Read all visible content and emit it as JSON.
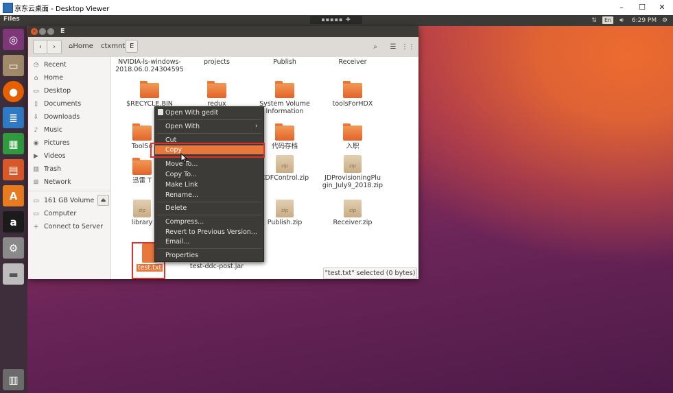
{
  "viewer": {
    "title": "京东云桌面 - Desktop Viewer",
    "min": "–",
    "max": "☐",
    "close": "✕"
  },
  "top_panel": {
    "app_title": "Files",
    "remote_bar": "▪▪▪▪▪ ✚ ▪▪▪▪▪",
    "keyboard": "En",
    "time": "6:29 PM"
  },
  "launcher": [
    {
      "name": "dash",
      "glyph": "◎",
      "color": "#7e3878"
    },
    {
      "name": "files",
      "glyph": "▭",
      "color": "#a08a6a"
    },
    {
      "name": "firefox",
      "glyph": "●",
      "color": "#e66000"
    },
    {
      "name": "writer",
      "glyph": "≣",
      "color": "#2e7ac4"
    },
    {
      "name": "calc",
      "glyph": "▦",
      "color": "#2f9a3e"
    },
    {
      "name": "impress",
      "glyph": "▤",
      "color": "#d9582a"
    },
    {
      "name": "software",
      "glyph": "A",
      "color": "#e87a1f"
    },
    {
      "name": "amazon",
      "glyph": "a",
      "color": "#1b1b1b"
    },
    {
      "name": "settings",
      "glyph": "⚙",
      "color": "#8a8a8a"
    },
    {
      "name": "drive",
      "glyph": "▬",
      "color": "#bdbdbd"
    },
    {
      "name": "trash",
      "glyph": "▥",
      "color": "#6b6b6b"
    }
  ],
  "window": {
    "title": "E",
    "breadcrumb": [
      "Home",
      "ctxmnt",
      "E"
    ],
    "sidebar": [
      "Recent",
      "Home",
      "Desktop",
      "Documents",
      "Downloads",
      "Music",
      "Pictures",
      "Videos",
      "Trash",
      "Network",
      "161 GB Volume",
      "Computer",
      "Connect to Server"
    ],
    "files_top": [
      "NVIDIA-ls-windows-\n2018.06.0.24304595",
      "projects",
      "Publish",
      "Receiver"
    ],
    "row1": [
      "$RECYCLE.BIN",
      "redux",
      "System Volume\nInformation",
      "toolsForHDX"
    ],
    "row2": [
      "ToolSo",
      "代码存档",
      "入职"
    ],
    "row3": [
      "迅雷 T",
      "CDFControl.zip",
      "JDProvisioningPlu\ngin_July9_2018.zip"
    ],
    "row4": [
      "library",
      "Publish.zip",
      "Receiver.zip"
    ],
    "row5": [
      "test.txt",
      "test-ddc-post.jar"
    ],
    "zip_label": "zip",
    "jar_label": "jar",
    "status": "\"test.txt\" selected (0 bytes)"
  },
  "context_menu": {
    "items": [
      "Open With gedit",
      "Open With",
      "Cut",
      "Copy",
      "Move To...",
      "Copy To...",
      "Make Link",
      "Rename...",
      "Delete",
      "Compress...",
      "Revert to Previous Version...",
      "Email...",
      "Properties"
    ]
  }
}
